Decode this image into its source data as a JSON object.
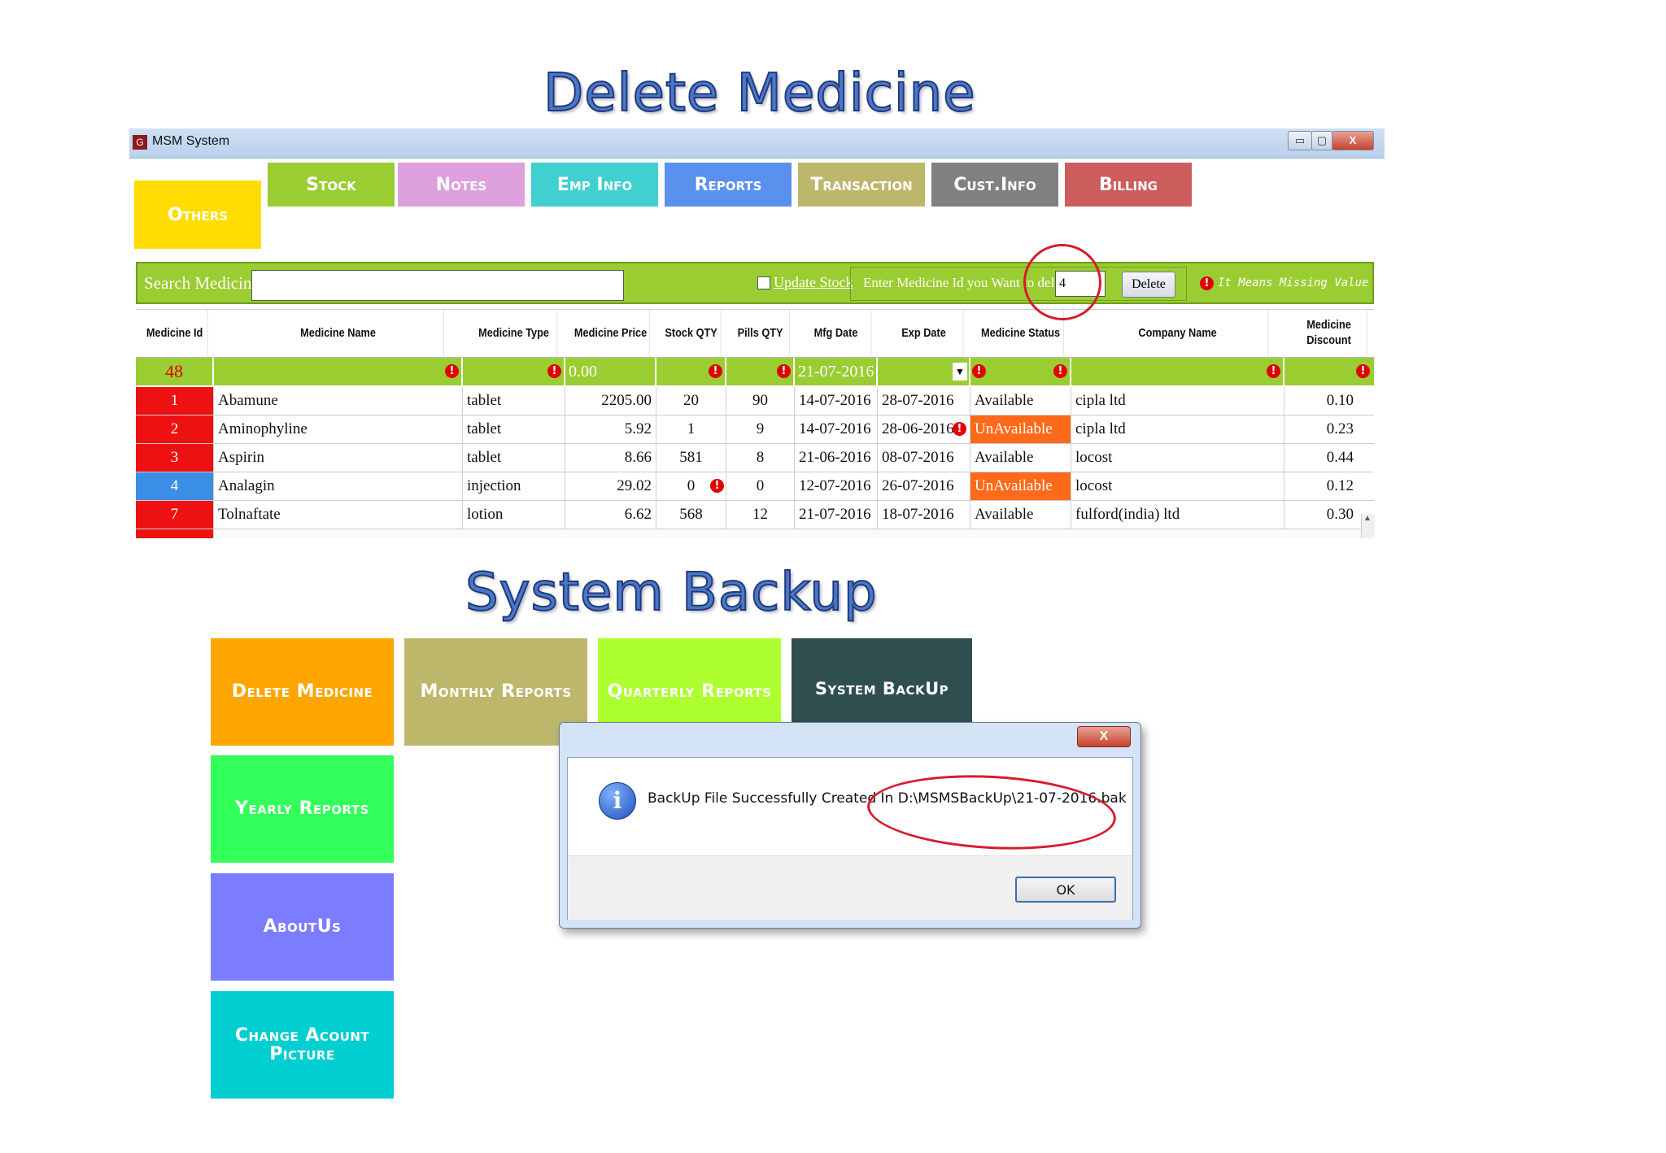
{
  "headings": {
    "delete": "Delete Medicine",
    "backup": "System Backup"
  },
  "window": {
    "title": "MSM System",
    "icon_letter": "G",
    "minimize": "▭",
    "maximize": "▢",
    "close": "X"
  },
  "tabs": [
    {
      "label": "Others",
      "color": "#ffdd00"
    },
    {
      "label": "Stock",
      "color": "#9acd32"
    },
    {
      "label": "Notes",
      "color": "#dda0dd"
    },
    {
      "label": "Emp Info",
      "color": "#40d0d0"
    },
    {
      "label": "Reports",
      "color": "#5a90ee"
    },
    {
      "label": "Transaction",
      "color": "#bdb76b"
    },
    {
      "label": "Cust.Info",
      "color": "#808080"
    },
    {
      "label": "Billing",
      "color": "#cd5c5c"
    }
  ],
  "search": {
    "label": "Search Medicine",
    "value": ""
  },
  "update_stock": {
    "label": "Update Stock"
  },
  "delete_form": {
    "label": "Enter Medicine Id you Want to delete",
    "value": "4",
    "button": "Delete"
  },
  "hint": "It Means Missing Value",
  "table": {
    "headers": [
      "Medicine Id",
      "Medicine Name",
      "Medicine Type",
      "Medicine Price",
      "Stock QTY",
      "Pills QTY",
      "Mfg Date",
      "Exp Date",
      "Medicine Status",
      "Company Name",
      "Medicine Discount"
    ],
    "filter_row": {
      "id": "48",
      "price": "0.00",
      "mfg_date": "21-07-2016"
    },
    "rows": [
      {
        "id": "1",
        "name": "Abamune",
        "type": "tablet",
        "price": "2205.00",
        "stock": "20",
        "pills": "90",
        "mfg": "14-07-2016",
        "exp": "28-07-2016",
        "status": "Available",
        "company": "cipla ltd",
        "discount": "0.10",
        "id_color": "#ee1111"
      },
      {
        "id": "2",
        "name": "Aminophyline",
        "type": "tablet",
        "price": "5.92",
        "stock": "1",
        "pills": "9",
        "mfg": "14-07-2016",
        "exp": "28-06-2016",
        "status": "UnAvailable",
        "company": "cipla ltd",
        "discount": "0.23",
        "id_color": "#ee1111"
      },
      {
        "id": "3",
        "name": "Aspirin",
        "type": "tablet",
        "price": "8.66",
        "stock": "581",
        "pills": "8",
        "mfg": "21-06-2016",
        "exp": "08-07-2016",
        "status": "Available",
        "company": "locost",
        "discount": "0.44",
        "id_color": "#ee1111"
      },
      {
        "id": "4",
        "name": "Analagin",
        "type": "injection",
        "price": "29.02",
        "stock": "0",
        "pills": "0",
        "mfg": "12-07-2016",
        "exp": "26-07-2016",
        "status": "UnAvailable",
        "company": "locost",
        "discount": "0.12",
        "id_color": "#3a8ee6"
      },
      {
        "id": "7",
        "name": "Tolnaftate",
        "type": "lotion",
        "price": "6.62",
        "stock": "568",
        "pills": "12",
        "mfg": "21-07-2016",
        "exp": "18-07-2016",
        "status": "Available",
        "company": "fulford(india) ltd",
        "discount": "0.30",
        "id_color": "#ee1111"
      }
    ]
  },
  "tiles": [
    {
      "label": "Delete Medicine",
      "color": "#ffa500"
    },
    {
      "label": "Monthly Reports",
      "color": "#bdb76b"
    },
    {
      "label": "Quarterly Reports",
      "color": "#adff2f"
    },
    {
      "label": "System BackUp",
      "color": "#2f4f4f"
    },
    {
      "label": "Yearly Reports",
      "color": "#32ff5a"
    },
    {
      "label": "AboutUs",
      "color": "#7b7cff"
    },
    {
      "label": "Change Acount Picture",
      "color": "#00ced1"
    }
  ],
  "dialog": {
    "close": "X",
    "message": "BackUp File Successfully Created In D:\\MSMSBackUp\\21-07-2016.bak",
    "ok": "OK"
  }
}
